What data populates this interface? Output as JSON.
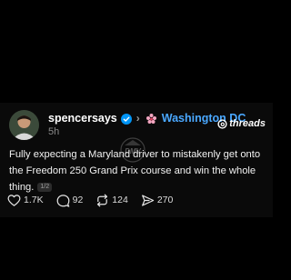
{
  "post": {
    "username": "spencersays",
    "community": "Washington DC",
    "time": "5h",
    "brand": "threads",
    "text": "Fully expecting a Maryland driver to mistakenly get onto the Freedom 250 Grand Prix course and win the whole thing.",
    "page_badge": "1/2",
    "watermark": "DMV",
    "colors": {
      "background": "#000000",
      "card": "#0a0a0a",
      "community_link": "#4aa8ff",
      "verified": "#0095f6"
    },
    "icons": {
      "verified": "verified-badge-icon",
      "community": "dc-flower-icon",
      "brand": "threads-logo-icon"
    }
  },
  "actions": {
    "likes": "1.7K",
    "comments": "92",
    "reposts": "124",
    "shares": "270",
    "icons": [
      "heart-icon",
      "comment-icon",
      "repost-icon",
      "send-icon"
    ]
  }
}
